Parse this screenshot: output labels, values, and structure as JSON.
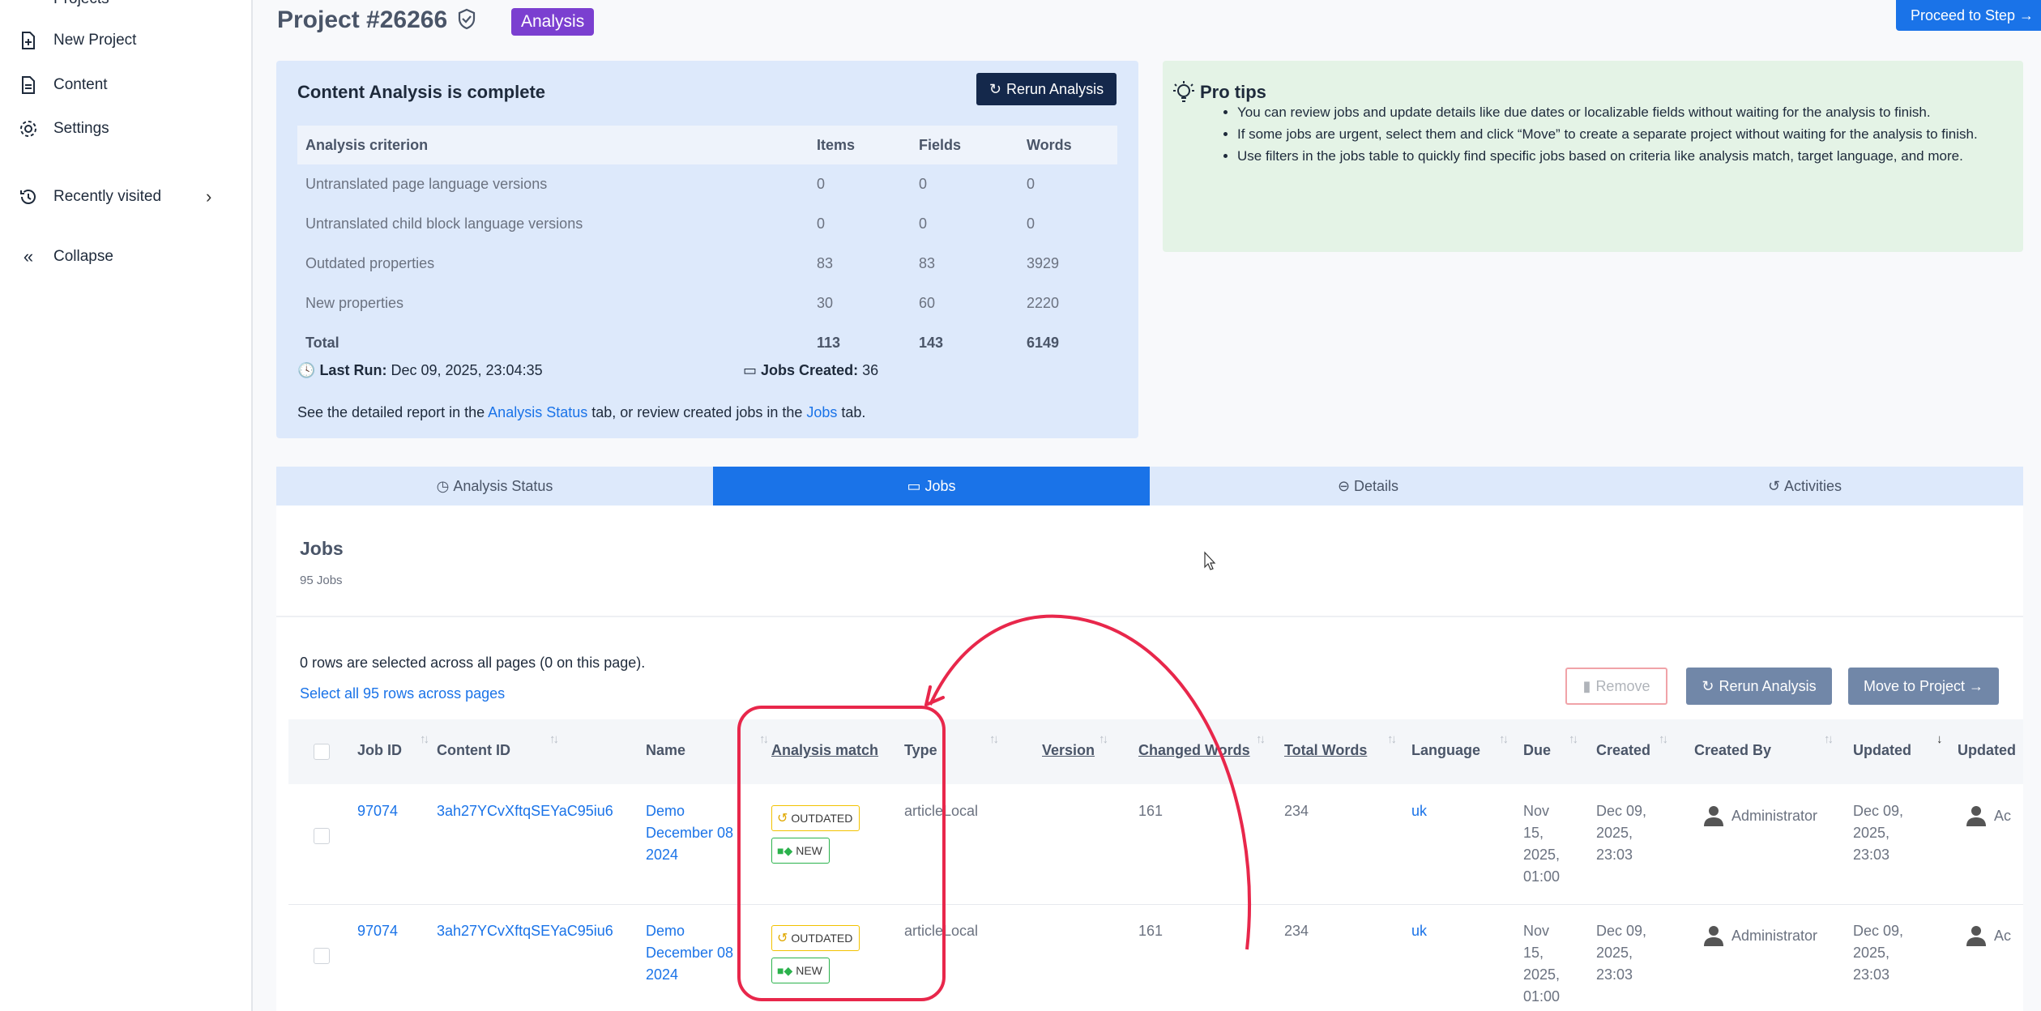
{
  "sidebar": {
    "items": [
      {
        "label": "Projects"
      },
      {
        "label": "New Project"
      },
      {
        "label": "Content"
      },
      {
        "label": "Settings"
      },
      {
        "label": "Recently visited"
      },
      {
        "label": "Collapse"
      }
    ]
  },
  "header": {
    "project_title": "Project #26266",
    "status_badge": "Analysis",
    "proceed_button": "Proceed to Step →"
  },
  "analysis": {
    "title": "Content Analysis is complete",
    "rerun_button": "Rerun Analysis",
    "columns": [
      "Analysis criterion",
      "Items",
      "Fields",
      "Words"
    ],
    "rows": [
      [
        "Untranslated page language versions",
        "0",
        "0",
        "0"
      ],
      [
        "Untranslated child block language versions",
        "0",
        "0",
        "0"
      ],
      [
        "Outdated properties",
        "83",
        "83",
        "3929"
      ],
      [
        "New properties",
        "30",
        "60",
        "2220"
      ],
      [
        "Total",
        "113",
        "143",
        "6149"
      ]
    ],
    "last_run_label": "Last Run:",
    "last_run_value": "Dec 09, 2025, 23:04:35",
    "jobs_created_label": "Jobs Created:",
    "jobs_created_value": "36",
    "report_prefix": "See the detailed report in the ",
    "report_link1": "Analysis Status",
    "report_mid": " tab, or review created jobs in the ",
    "report_link2": "Jobs",
    "report_suffix": " tab."
  },
  "tips": {
    "title": "Pro tips",
    "items": [
      "You can review jobs and update details like due dates or localizable fields without waiting for the analysis to finish.",
      "If some jobs are urgent, select them and click “Move” to create a separate project without waiting for the analysis to finish.",
      "Use filters in the jobs table to quickly find specific jobs based on criteria like analysis match, target language, and more."
    ]
  },
  "tabs": [
    {
      "label": "Analysis Status"
    },
    {
      "label": "Jobs"
    },
    {
      "label": "Details"
    },
    {
      "label": "Activities"
    }
  ],
  "jobs": {
    "title": "Jobs",
    "count": "95 Jobs",
    "selection_text": "0 rows are selected across all pages (0 on this page).",
    "select_all": "Select all 95 rows across pages",
    "remove_button": "Remove",
    "rerun_button": "Rerun Analysis",
    "move_button": "Move to Project →",
    "columns": [
      "Job ID",
      "Content ID",
      "Name",
      "Analysis match",
      "Type",
      "Version",
      "Changed Words",
      "Total Words",
      "Language",
      "Due",
      "Created",
      "Created By",
      "Updated",
      "Updated"
    ],
    "rows": [
      {
        "job_id": "97074",
        "content_id": "3ah27YCvXftqSEYaC95iu6",
        "name": "Demo December 08 2024",
        "tag1": "OUTDATED",
        "tag2": "NEW",
        "type": "articleLocal",
        "changed_words": "161",
        "total_words": "234",
        "language": "uk",
        "due": "Nov 15, 2025, 01:00",
        "created": "Dec 09, 2025, 23:03",
        "created_by": "Administrator",
        "updated": "Dec 09, 2025, 23:03",
        "updated_by": "Ac"
      },
      {
        "job_id": "97074",
        "content_id": "3ah27YCvXftqSEYaC95iu6",
        "name": "Demo December 08 2024",
        "tag1": "OUTDATED",
        "tag2": "NEW",
        "type": "articleLocal",
        "changed_words": "161",
        "total_words": "234",
        "language": "uk",
        "due": "Nov 15, 2025, 01:00",
        "created": "Dec 09, 2025, 23:03",
        "created_by": "Administrator",
        "updated": "Dec 09, 2025, 23:03",
        "updated_by": "Ac"
      }
    ]
  },
  "colors": {
    "accent": "#1a73e8",
    "badge": "#7b3fd0",
    "annotation": "#e8274b",
    "dark_button": "#14284b",
    "slate_button": "#7187a8"
  }
}
